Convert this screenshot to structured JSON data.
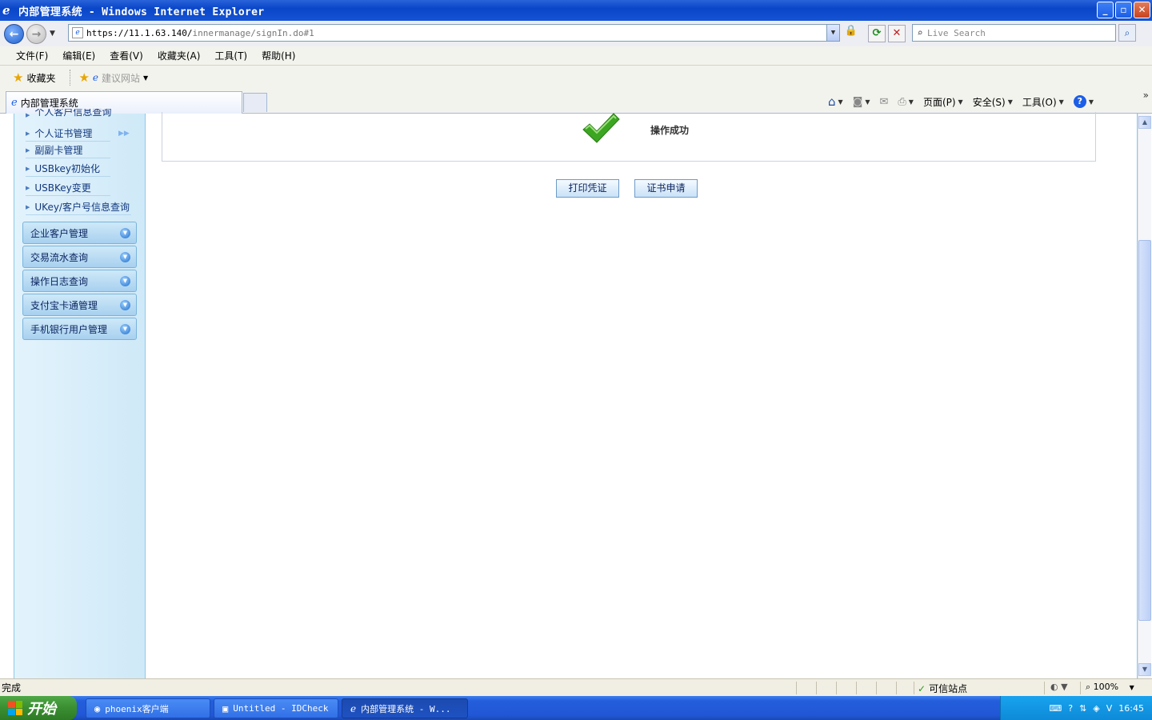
{
  "window": {
    "title": "内部管理系统 - Windows Internet Explorer",
    "min": "_",
    "max": "▫",
    "close": "✕"
  },
  "address": {
    "url_host": "https://11.1.63.140/",
    "url_path": "innermanage/signIn.do#1",
    "search_placeholder": "Live Search"
  },
  "menu": [
    "文件(F)",
    "编辑(E)",
    "查看(V)",
    "收藏夹(A)",
    "工具(T)",
    "帮助(H)"
  ],
  "favorites": {
    "label": "收藏夹",
    "suggested": "建议网站"
  },
  "tab": {
    "title": "内部管理系统"
  },
  "commands": {
    "page": "页面(P)",
    "safety": "安全(S)",
    "tools": "工具(O)"
  },
  "sidebar": {
    "partial_item": "个人客户信息查询",
    "sub_items": [
      "个人证书管理",
      "副副卡管理",
      "USBkey初始化",
      "USBKey变更",
      "UKey/客户号信息查询"
    ],
    "groups": [
      "企业客户管理",
      "交易流水查询",
      "操作日志查询",
      "支付宝卡通管理",
      "手机银行用户管理"
    ]
  },
  "main": {
    "success_message": "操作成功",
    "print_button": "打印凭证",
    "apply_button": "证书申请"
  },
  "status": {
    "done": "完成",
    "zone": "可信站点",
    "zoom": "100%"
  },
  "taskbar": {
    "start": "开始",
    "tasks": [
      "phoenix客户端",
      "Untitled - IDCheck",
      "内部管理系统 - W..."
    ],
    "clock": "16:45"
  },
  "colors": {
    "success_green": "#3ca522",
    "titlebar_blue": "#0a46c8",
    "sidebar_bg": "#d8eefa"
  }
}
